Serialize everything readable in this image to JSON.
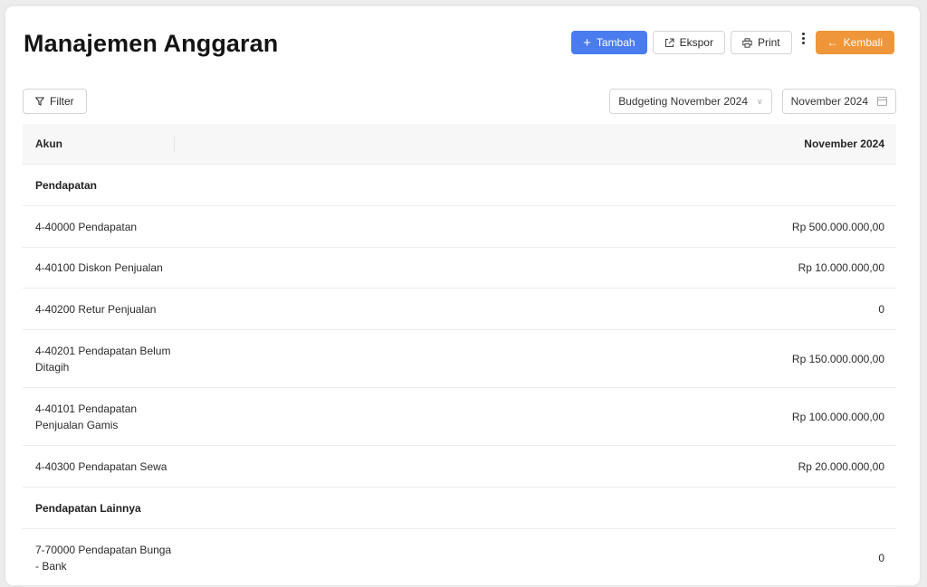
{
  "header": {
    "title": "Manajemen Anggaran",
    "actions": {
      "add_label": "Tambah",
      "export_label": "Ekspor",
      "print_label": "Print",
      "back_label": "Kembali"
    }
  },
  "toolbar": {
    "filter_label": "Filter",
    "budget_select": "Budgeting November 2024",
    "period_picker": "November 2024"
  },
  "table": {
    "columns": [
      "Akun",
      "November 2024"
    ],
    "rows": [
      {
        "account": "Pendapatan",
        "value": "",
        "group": true
      },
      {
        "account": "4-40000 Pendapatan",
        "value": "Rp 500.000.000,00"
      },
      {
        "account": "4-40100 Diskon Penjualan",
        "value": "Rp 10.000.000,00"
      },
      {
        "account": "4-40200 Retur Penjualan",
        "value": "0"
      },
      {
        "account": "4-40201 Pendapatan Belum Ditagih",
        "value": "Rp 150.000.000,00"
      },
      {
        "account": "4-40101 Pendapatan Penjualan Gamis",
        "value": "Rp 100.000.000,00"
      },
      {
        "account": "4-40300 Pendapatan Sewa",
        "value": "Rp 20.000.000,00"
      },
      {
        "account": "Pendapatan Lainnya",
        "value": "",
        "group": true
      },
      {
        "account": "7-70000 Pendapatan Bunga - Bank",
        "value": "0"
      }
    ]
  },
  "colors": {
    "primary": "#4a7cf0",
    "back_button": "#ef963a"
  }
}
